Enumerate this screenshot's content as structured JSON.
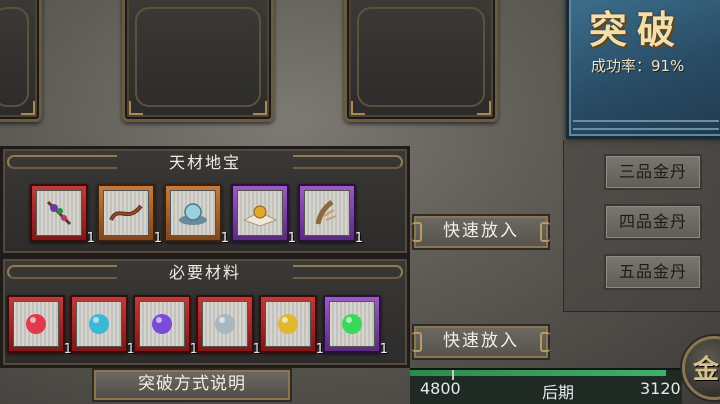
{
  "breakthrough": {
    "title": "突破",
    "success_rate_label": "成功率：",
    "success_rate_value": "91%"
  },
  "pills": [
    {
      "label": "三品金丹"
    },
    {
      "label": "四品金丹"
    },
    {
      "label": "五品金丹"
    }
  ],
  "treasures": {
    "title": "天材地宝",
    "items": [
      {
        "icon": "herb-branch-icon",
        "rarity": "red",
        "count": "1"
      },
      {
        "icon": "dragon-whip-icon",
        "rarity": "orange",
        "count": "1"
      },
      {
        "icon": "crystal-bowl-icon",
        "rarity": "orange",
        "count": "1"
      },
      {
        "icon": "golden-pearl-icon",
        "rarity": "purple",
        "count": "1"
      },
      {
        "icon": "beast-claw-icon",
        "rarity": "purple",
        "count": "1"
      }
    ]
  },
  "materials": {
    "title": "必要材料",
    "items": [
      {
        "icon": "red-orb-icon",
        "rarity": "red",
        "color": "#e23a4a",
        "count": "1"
      },
      {
        "icon": "cyan-orb-icon",
        "rarity": "red",
        "color": "#3ab8d8",
        "count": "1"
      },
      {
        "icon": "violet-orb-icon",
        "rarity": "red",
        "color": "#7a4ad8",
        "count": "1"
      },
      {
        "icon": "silver-orb-icon",
        "rarity": "red",
        "color": "#a8b8c0",
        "count": "1"
      },
      {
        "icon": "gold-orb-icon",
        "rarity": "red",
        "color": "#e0b830",
        "count": "1"
      },
      {
        "icon": "green-orb-icon",
        "rarity": "purple",
        "color": "#3ad85a",
        "count": "1"
      }
    ]
  },
  "buttons": {
    "quick_put_1": "快速放入",
    "quick_put_2": "快速放入",
    "explain": "突破方式说明"
  },
  "progress": {
    "left_value": "4800",
    "stage": "后期",
    "right_value": "3120",
    "fill_fraction": 0.94
  },
  "coin": {
    "label": "金"
  }
}
